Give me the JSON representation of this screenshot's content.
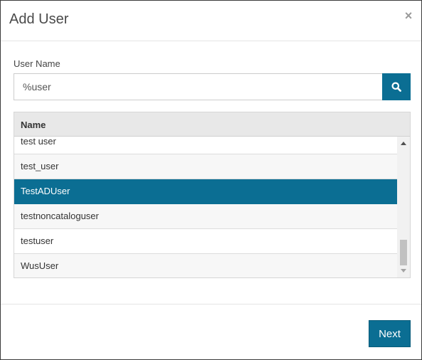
{
  "dialog": {
    "title": "Add User",
    "close_label": "×"
  },
  "form": {
    "user_name_label": "User Name",
    "search_value": "%user",
    "search_icon": "search-icon"
  },
  "grid": {
    "header": "Name",
    "rows": [
      {
        "name": "test user",
        "selected": false
      },
      {
        "name": "test_user",
        "selected": false
      },
      {
        "name": "TestADUser",
        "selected": true
      },
      {
        "name": "testnoncataloguser",
        "selected": false
      },
      {
        "name": "testuser",
        "selected": false
      },
      {
        "name": "WusUser",
        "selected": false
      }
    ]
  },
  "footer": {
    "next_label": "Next"
  },
  "colors": {
    "accent": "#0b6e93"
  }
}
